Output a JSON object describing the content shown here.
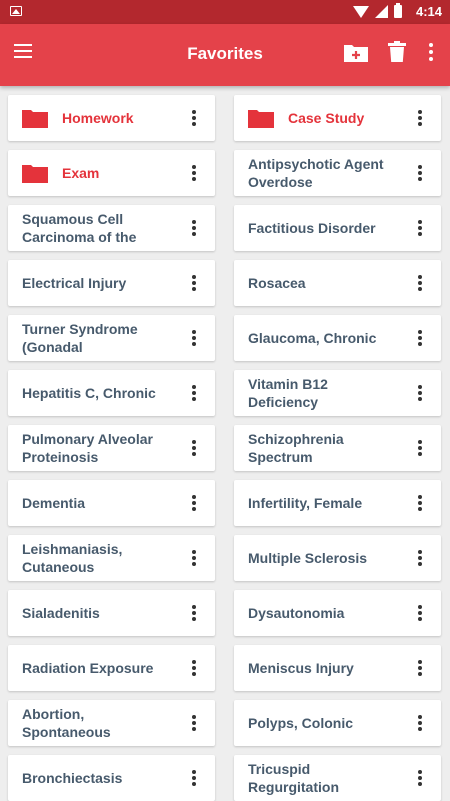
{
  "status_bar": {
    "time": "4:14"
  },
  "app_bar": {
    "title": "Favorites",
    "icons": [
      "menu-icon",
      "folder-add-icon",
      "trash-icon",
      "more-vert-icon"
    ],
    "accent_color": "#e4424a"
  },
  "folders": [
    {
      "label": "Homework"
    },
    {
      "label": "Case Study"
    },
    {
      "label": "Exam"
    }
  ],
  "items": [
    "Antipsychotic Agent Overdose",
    "Squamous Cell Carcinoma of the",
    "Factitious Disorder",
    "Electrical Injury",
    "Rosacea",
    "Turner Syndrome (Gonadal",
    "Glaucoma, Chronic",
    "Hepatitis C, Chronic",
    "Vitamin B12 Deficiency",
    "Pulmonary Alveolar Proteinosis",
    "Schizophrenia Spectrum",
    "Dementia",
    "Infertility, Female",
    "Leishmaniasis, Cutaneous",
    "Multiple Sclerosis",
    "Sialadenitis",
    "Dysautonomia",
    "Radiation Exposure",
    "Meniscus Injury",
    "Abortion, Spontaneous",
    "Polyps, Colonic",
    "Bronchiectasis",
    "Tricuspid Regurgitation"
  ]
}
